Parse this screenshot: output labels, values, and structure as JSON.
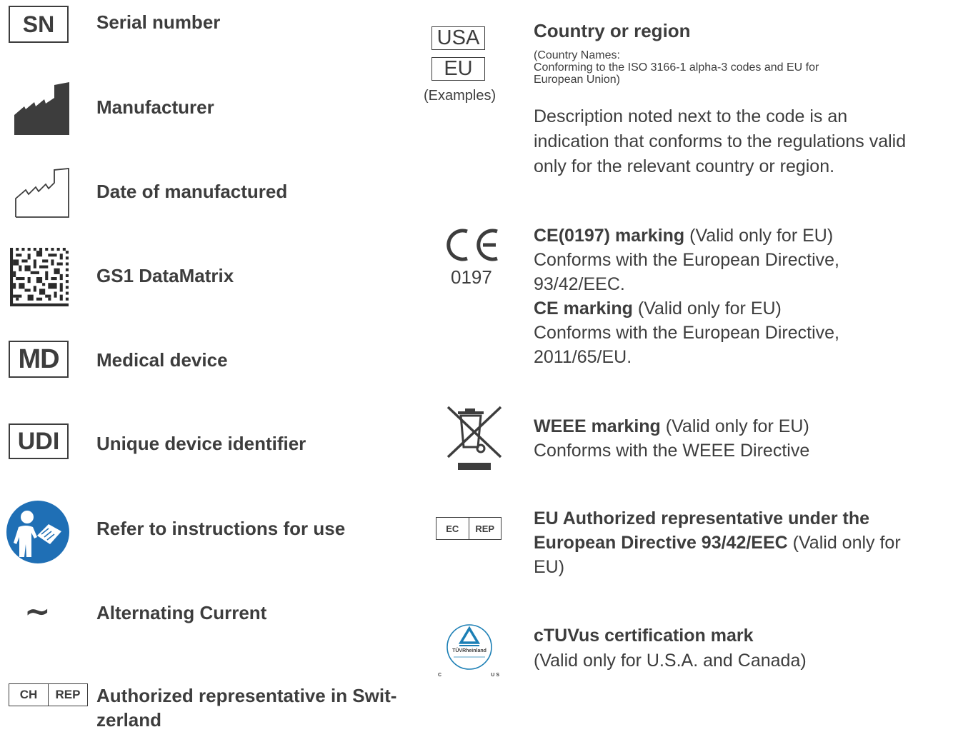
{
  "left": {
    "serial": {
      "icon_text": "SN",
      "label": "Serial number"
    },
    "manufacturer": {
      "label": "Manufacturer"
    },
    "date": {
      "label": "Date of manufactured"
    },
    "datamatrix": {
      "label": "GS1 DataMatrix"
    },
    "md": {
      "icon_text": "MD",
      "label": "Medical device"
    },
    "udi": {
      "icon_text": "UDI",
      "label": "Unique device identifier"
    },
    "ifu": {
      "label": "Refer to instructions for use"
    },
    "ac": {
      "icon_text": "∼",
      "label": "Alternating Current"
    },
    "chrep": {
      "left": "CH",
      "right": "REP",
      "label_line1": "Authorized representative in Swit-",
      "label_line2": "zerland"
    }
  },
  "right": {
    "country": {
      "code1": "USA",
      "code2": "EU",
      "examples": "(Examples)",
      "title": "Country or region",
      "note_line1": "(Country Names:",
      "note_line2": "Conforming to the ISO 3166-1 alpha-3 codes and EU for",
      "note_line3": "European Union)",
      "desc_line1": "Description noted next to the code is an",
      "desc_line2": "indication that conforms to the regulations valid",
      "desc_line3": "only for the relevant country or region."
    },
    "ce": {
      "mark": "CE",
      "number": "0197",
      "title1": "CE(0197) marking",
      "valid1": " (Valid only for EU)",
      "line2": "Conforms with the European Directive,",
      "line3": "93/42/EEC.",
      "title2": "CE marking",
      "valid2": " (Valid only for EU)",
      "line5": "Conforms with the European Directive,",
      "line6": "2011/65/EU."
    },
    "weee": {
      "title": " WEEE marking",
      "valid": " (Valid only for EU)",
      "line2": "Conforms with the WEEE Directive"
    },
    "ecrep": {
      "left": "EC",
      "right": "REP",
      "line1": "EU Authorized representative under the",
      "line2_bold": "European Directive 93/42/EEC",
      "line2_rest": " (Valid only for",
      "line3": "EU)"
    },
    "tuv": {
      "logo_text": "TÜVRheinland",
      "c": "C",
      "us": "US",
      "title": "cTUVus certification mark",
      "line2": "(Valid only for U.S.A. and Canada)"
    }
  },
  "colors": {
    "text": "#3d3d3d",
    "ifu_blue": "#1f6fb5",
    "tuv_blue": "#1c7fb5"
  }
}
